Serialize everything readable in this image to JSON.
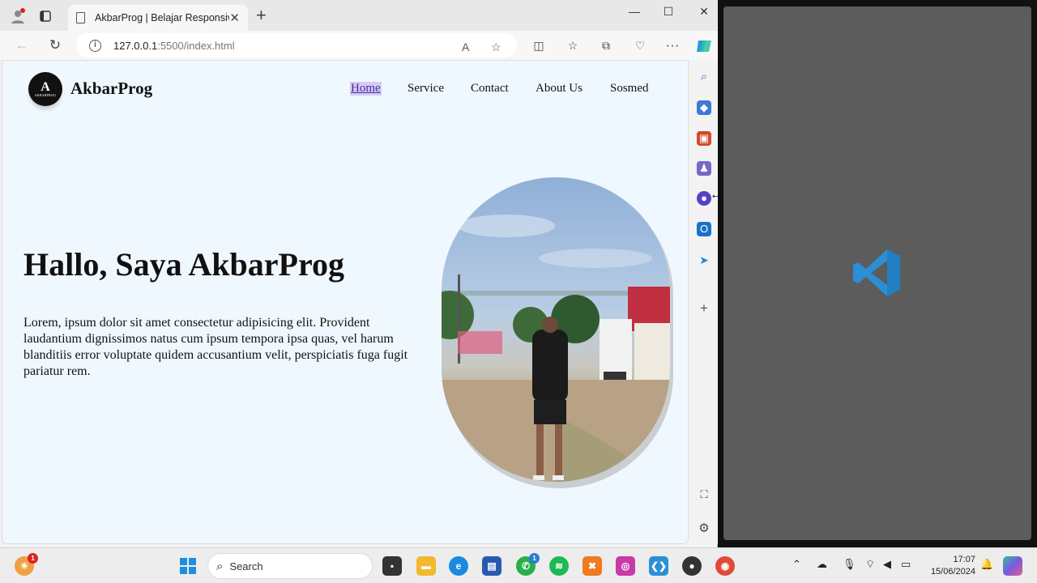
{
  "browser": {
    "tab_title": "AkbarProg | Belajar Responsive",
    "url_host": "127.0.0.1",
    "url_rest": ":5500/index.html"
  },
  "page": {
    "logo_mark": "A",
    "logo_small": "AKBARPROG",
    "brand": "AkbarProg",
    "nav": [
      "Home",
      "Service",
      "Contact",
      "About Us",
      "Sosmed"
    ],
    "hero_title": "Hallo, Saya AkbarProg",
    "hero_text": "Lorem, ipsum dolor sit amet consectetur adipisicing elit. Provident laudantium dignissimos natus cum ipsum tempora ipsa quas, vel harum blanditiis error voluptate quidem accusantium velit, perspiciatis fuga fugit pariatur rem."
  },
  "taskbar": {
    "search_label": "Search",
    "weather_badge": "1",
    "whatsapp_badge": "1",
    "time": "17:07",
    "date": "15/06/2024"
  },
  "colors": {
    "page_bg": "#f0f8ff",
    "vscode_blue": "#2d8fd8",
    "active_nav_bg": "#d6ccf5"
  }
}
